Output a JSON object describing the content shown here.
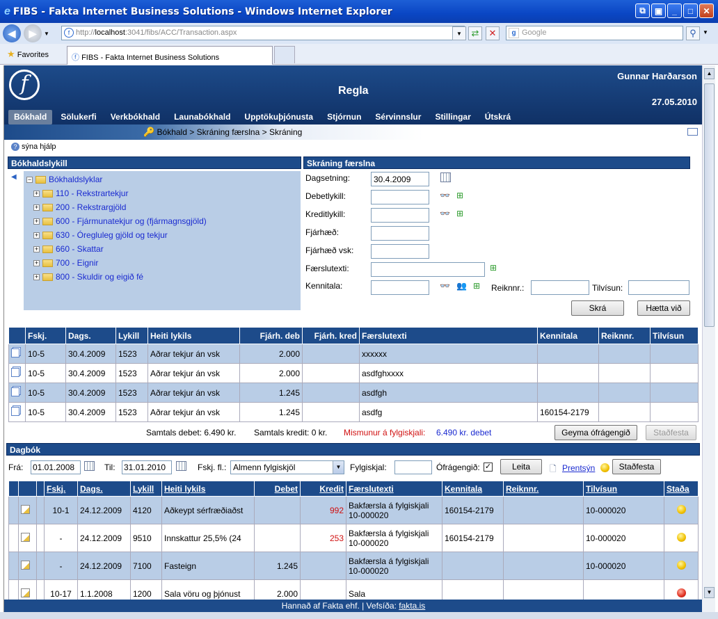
{
  "window": {
    "title": "FIBS - Fakta Internet Business Solutions - Windows Internet Explorer"
  },
  "browser": {
    "url_prefix": "http://",
    "url_host": "localhost",
    "url_rest": ":3041/fibs/ACC/Transaction.aspx",
    "search_placeholder": "Google",
    "favorites_label": "Favorites",
    "tab_label": "FIBS - Fakta Internet Business Solutions"
  },
  "header": {
    "title": "Regla",
    "user": "Gunnar Harðarson",
    "date": "27.05.2010",
    "menu": [
      "Bókhald",
      "Sölukerfi",
      "Verkbókhald",
      "Launabókhald",
      "Upptökuþjónusta",
      "Stjórnun",
      "Sérvinnslur",
      "Stillingar",
      "Útskrá"
    ],
    "breadcrumb": "Bókhald > Skráning færslna > Skráning"
  },
  "help_label": "sýna hjálp",
  "tree": {
    "title": "Bókhaldslykill",
    "root": "Bókhaldslyklar",
    "items": [
      "110 - Rekstrartekjur",
      "200 - Rekstrargjöld",
      "600 - Fjármunatekjur og (fjármagnsgjöld)",
      "630 - Óregluleg gjöld og tekjur",
      "660 - Skattar",
      "700 - Eignir",
      "800 - Skuldir og eigið fé"
    ]
  },
  "entry": {
    "title": "Skráning færslna",
    "date_label": "Dagsetning:",
    "date_value": "30.4.2009",
    "debit_label": "Debetlykill:",
    "credit_label": "Kreditlykill:",
    "amount_label": "Fjárhæð:",
    "amount_vat_label": "Fjárhæð vsk:",
    "text_label": "Færslutexti:",
    "kt_label": "Kennitala:",
    "invoice_label": "Reiknnr.:",
    "ref_label": "Tilvísun:",
    "save_button": "Skrá",
    "cancel_button": "Hætta við"
  },
  "pending": {
    "columns": [
      "Fskj.",
      "Dags.",
      "Lykill",
      "Heiti lykils",
      "Fjárh. deb",
      "Fjárh. kred",
      "Færslutexti",
      "Kennitala",
      "Reiknnr.",
      "Tilvísun"
    ],
    "rows": [
      [
        "10-5",
        "30.4.2009",
        "1523",
        "Aðrar tekjur án vsk",
        "2.000",
        "",
        "xxxxxx",
        "",
        "",
        ""
      ],
      [
        "10-5",
        "30.4.2009",
        "1523",
        "Aðrar tekjur án vsk",
        "2.000",
        "",
        "asdfghxxxx",
        "",
        "",
        ""
      ],
      [
        "10-5",
        "30.4.2009",
        "1523",
        "Aðrar tekjur án vsk",
        "1.245",
        "",
        "asdfgh",
        "",
        "",
        ""
      ],
      [
        "10-5",
        "30.4.2009",
        "1523",
        "Aðrar tekjur án vsk",
        "1.245",
        "",
        "asdfg",
        "160154-2179",
        "",
        ""
      ]
    ],
    "total_debit": "Samtals debet: 6.490 kr.",
    "total_credit": "Samtals kredit: 0 kr.",
    "diff_label": "Mismunur á fylgiskjali:",
    "diff_value": "6.490 kr. debet",
    "keep_button": "Geyma ófrágengið",
    "confirm_button": "Staðfesta"
  },
  "journal": {
    "title": "Dagbók",
    "from_label": "Frá:",
    "from_value": "01.01.2008",
    "to_label": "Til:",
    "to_value": "31.01.2010",
    "type_label": "Fskj. fl.:",
    "type_value": "Almenn fylgiskjöl",
    "voucher_label": "Fylgiskjal:",
    "unfinished_label": "Ófrágengið:",
    "unfinished_checked": "✓",
    "search_button": "Leita",
    "print_link": "Prentsýn",
    "confirm_button": "Staðfesta",
    "columns": [
      "Fskj.",
      "Dags.",
      "Lykill",
      "Heiti lykils",
      "Debet",
      "Kredit",
      "Færslutexti",
      "Kennitala",
      "Reiknnr.",
      "Tilvísun",
      "Staða"
    ],
    "rows": [
      [
        "10-1",
        "24.12.2009",
        "4120",
        "Aðkeypt sérfræðiaðst",
        "",
        "992",
        "Bakfærsla á fylgiskjali 10-000020",
        "160154-2179",
        "",
        "10-000020",
        "ok"
      ],
      [
        "-",
        "24.12.2009",
        "9510",
        "Innskattur 25,5% (24",
        "",
        "253",
        "Bakfærsla á fylgiskjali 10-000020",
        "160154-2179",
        "",
        "10-000020",
        "ok"
      ],
      [
        "-",
        "24.12.2009",
        "7100",
        "Fasteign",
        "1.245",
        "",
        "Bakfærsla á fylgiskjali 10-000020",
        "",
        "",
        "10-000020",
        "ok"
      ],
      [
        "10-17",
        "1.1.2008",
        "1200",
        "Sala vöru og þjónust",
        "2.000",
        "",
        "Sala",
        "",
        "",
        "",
        "error"
      ]
    ]
  },
  "footer": {
    "text": "Hannað af Fakta ehf. | Vefsíða:",
    "link": "fakta.is"
  },
  "colors": {
    "header": "#1d4b8a",
    "row_alt": "#b9cde6",
    "credit": "#d01010"
  }
}
